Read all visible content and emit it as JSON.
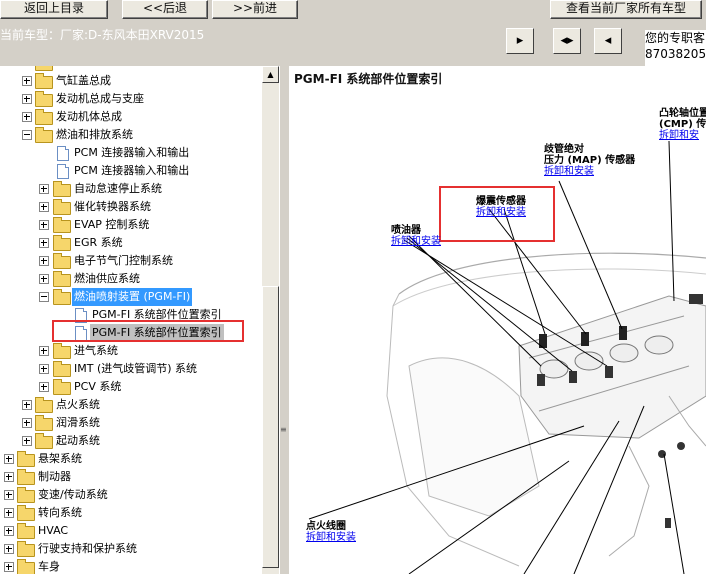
{
  "toolbar": {
    "back_to_catalog": "返回上目录",
    "previous": "<<后退",
    "next": ">>前进",
    "view_all": "查看当前厂家所有车型"
  },
  "header": {
    "car_model": "当前车型：厂家:D-东风本田XRV2015",
    "info_line1": "您的专职客",
    "info_line2": "87038205"
  },
  "tree": {
    "items": [
      {
        "label": "气缸盖总成"
      },
      {
        "label": "发动机总成与支座"
      },
      {
        "label": "发动机体总成"
      },
      {
        "label": "燃油和排放系统"
      },
      {
        "label": "PCM 连接器输入和输出"
      },
      {
        "label": "PCM 连接器输入和输出"
      },
      {
        "label": "自动怠速停止系统"
      },
      {
        "label": "催化转换器系统"
      },
      {
        "label": "EVAP 控制系统"
      },
      {
        "label": "EGR 系统"
      },
      {
        "label": "电子节气门控制系统"
      },
      {
        "label": "燃油供应系统"
      },
      {
        "label": "燃油喷射装置 (PGM-FI)"
      },
      {
        "label": "PGM-FI 系统部件位置索引"
      },
      {
        "label": "PGM-FI 系统部件位置索引"
      },
      {
        "label": "进气系统"
      },
      {
        "label": "IMT (进气歧管调节) 系统"
      },
      {
        "label": "PCV 系统"
      },
      {
        "label": "点火系统"
      },
      {
        "label": "润滑系统"
      },
      {
        "label": "起动系统"
      },
      {
        "label": "悬架系统"
      },
      {
        "label": "制动器"
      },
      {
        "label": "变速/传动系统"
      },
      {
        "label": "转向系统"
      },
      {
        "label": "HVAC"
      },
      {
        "label": "行驶支持和保护系统"
      },
      {
        "label": "车身"
      }
    ]
  },
  "content": {
    "title": "PGM-FI 系统部件位置索引",
    "components": [
      {
        "name": "凸轮轴位置",
        "name2": "(CMP) 传",
        "link": "拆卸和安"
      },
      {
        "name": "歧管绝对",
        "name2": "压力 (MAP) 传感器",
        "link": "拆卸和安装"
      },
      {
        "name": "爆震传感器",
        "link": "拆卸和安装"
      },
      {
        "name": "喷油器",
        "link": "拆卸和安装"
      },
      {
        "name": "点火线圈",
        "link": "拆卸和安装"
      }
    ]
  },
  "colors": {
    "highlight": "#e53030",
    "selection": "#3399ff",
    "link": "#0000ee"
  }
}
